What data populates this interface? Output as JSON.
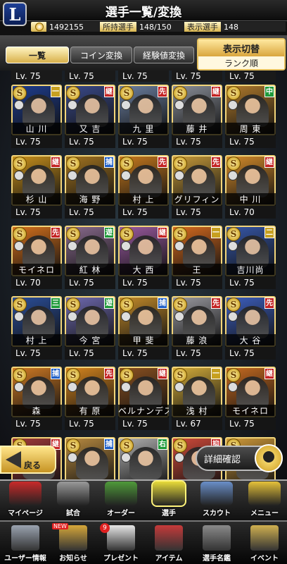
{
  "header": {
    "logo": "L",
    "title": "選手一覧/変換"
  },
  "stats": {
    "coins": "1492155",
    "owned_label": "所持選手",
    "owned_value": "148/150",
    "shown_label": "表示選手",
    "shown_value": "148"
  },
  "tabs": [
    {
      "label": "一覧",
      "active": true
    },
    {
      "label": "コイン変換",
      "active": false
    },
    {
      "label": "経験値変換",
      "active": false
    }
  ],
  "switch": {
    "label": "表示切替",
    "value": "ランク順"
  },
  "partial_row": [
    "Lv. 75",
    "Lv. 75",
    "Lv. 75",
    "Lv. 75",
    "Lv. 75"
  ],
  "cards": [
    {
      "name": "山 川",
      "lv": "Lv. 75",
      "pos": "一",
      "pos_color": "#c7a020",
      "bg": "#1e3d8f"
    },
    {
      "name": "又 吉",
      "lv": "Lv. 75",
      "pos": "継",
      "pos_color": "#c42424",
      "bg": "#3a4a8a"
    },
    {
      "name": "九 里",
      "lv": "Lv. 75",
      "pos": "先",
      "pos_color": "#c42424",
      "bg": "#6b7fa0"
    },
    {
      "name": "藤 井",
      "lv": "Lv. 75",
      "pos": "継",
      "pos_color": "#c42424",
      "bg": "#8a8f99"
    },
    {
      "name": "周 東",
      "lv": "Lv. 75",
      "pos": "中",
      "pos_color": "#1f9a3a",
      "bg": "#b07a2c"
    },
    {
      "name": "杉 山",
      "lv": "Lv. 75",
      "pos": "継",
      "pos_color": "#c42424",
      "bg": "#c8901c"
    },
    {
      "name": "海 野",
      "lv": "Lv. 75",
      "pos": "捕",
      "pos_color": "#1f5fc7",
      "bg": "#a37420"
    },
    {
      "name": "村 上",
      "lv": "Lv. 75",
      "pos": "先",
      "pos_color": "#c42424",
      "bg": "#c6791e"
    },
    {
      "name": "グリフィン",
      "lv": "Lv. 75",
      "pos": "先",
      "pos_color": "#c42424",
      "bg": "#c69a3a"
    },
    {
      "name": "中 川",
      "lv": "Lv. 70",
      "pos": "継",
      "pos_color": "#c42424",
      "bg": "#d48b2a"
    },
    {
      "name": "モイネロ",
      "lv": "Lv. 70",
      "pos": "先",
      "pos_color": "#c42424",
      "bg": "#d5701c"
    },
    {
      "name": "紅 林",
      "lv": "Lv. 75",
      "pos": "遊",
      "pos_color": "#1f9a3a",
      "bg": "#8a6b8e"
    },
    {
      "name": "大 西",
      "lv": "Lv. 75",
      "pos": "継",
      "pos_color": "#c42424",
      "bg": "#9a5aa0"
    },
    {
      "name": "王",
      "lv": "Lv. 75",
      "pos": "一",
      "pos_color": "#c7a020",
      "bg": "#d66a1e"
    },
    {
      "name": "吉川尚",
      "lv": "Lv. 75",
      "pos": "二",
      "pos_color": "#c7a020",
      "bg": "#3657a8"
    },
    {
      "name": "村 上",
      "lv": "Lv. 75",
      "pos": "三",
      "pos_color": "#1f9a3a",
      "bg": "#2b4f9a"
    },
    {
      "name": "今 宮",
      "lv": "Lv. 75",
      "pos": "遊",
      "pos_color": "#1f9a3a",
      "bg": "#6f6ab0"
    },
    {
      "name": "甲 斐",
      "lv": "Lv. 75",
      "pos": "捕",
      "pos_color": "#1f5fc7",
      "bg": "#c28a2a"
    },
    {
      "name": "藤 浪",
      "lv": "Lv. 75",
      "pos": "先",
      "pos_color": "#c42424",
      "bg": "#9a9aa0"
    },
    {
      "name": "大 谷",
      "lv": "Lv. 75",
      "pos": "先",
      "pos_color": "#c42424",
      "bg": "#3d5fbf"
    },
    {
      "name": "森",
      "lv": "Lv. 75",
      "pos": "捕",
      "pos_color": "#1f5fc7",
      "bg": "#d07a24"
    },
    {
      "name": "有 原",
      "lv": "Lv. 75",
      "pos": "先",
      "pos_color": "#c42424",
      "bg": "#d6851e"
    },
    {
      "name": "ベルナンデス",
      "lv": "Lv. 75",
      "pos": "継",
      "pos_color": "#c42424",
      "bg": "#8a5020"
    },
    {
      "name": "浅 村",
      "lv": "Lv. 67",
      "pos": "一",
      "pos_color": "#c7a020",
      "bg": "#d5ad3a"
    },
    {
      "name": "モイネロ",
      "lv": "Lv. 75",
      "pos": "継",
      "pos_color": "#c42424",
      "bg": "#c66a20"
    },
    {
      "name": "",
      "lv": "",
      "pos": "継",
      "pos_color": "#c42424",
      "bg": "#a03a3a"
    },
    {
      "name": "",
      "lv": "",
      "pos": "捕",
      "pos_color": "#1f5fc7",
      "bg": "#b88a40"
    },
    {
      "name": "",
      "lv": "",
      "pos": "右",
      "pos_color": "#1f9a3a",
      "bg": "#b0b0b0"
    },
    {
      "name": "",
      "lv": "",
      "pos": "抑",
      "pos_color": "#c42424",
      "bg": "#d04a3a"
    },
    {
      "name": "",
      "lv": "",
      "pos": "",
      "pos_color": "#c42424",
      "bg": "#d09a3a"
    }
  ],
  "buttons": {
    "back": "戻る",
    "detail": "詳細確認"
  },
  "nav_main": [
    {
      "label": "マイページ",
      "icon": "mypage-icon",
      "color": "#c92a2a"
    },
    {
      "label": "試合",
      "icon": "stadium-icon",
      "color": "#9a9a9a"
    },
    {
      "label": "オーダー",
      "icon": "field-icon",
      "color": "#4f9a3a"
    },
    {
      "label": "選手",
      "icon": "player-icon",
      "color": "#e8dc3a"
    },
    {
      "label": "スカウト",
      "icon": "scout-icon",
      "color": "#6a8fc9"
    },
    {
      "label": "メニュー",
      "icon": "menu-icon",
      "color": "#e6c23a"
    }
  ],
  "nav_sub": [
    {
      "label": "ユーザー情報",
      "icon": "user-info-icon",
      "color": "#9aa3b0",
      "badge": ""
    },
    {
      "label": "お知らせ",
      "icon": "notice-icon",
      "color": "#d6a73a",
      "badge": "NEW"
    },
    {
      "label": "プレゼント",
      "icon": "gift-icon",
      "color": "#e7e7e7",
      "badge": "9"
    },
    {
      "label": "アイテム",
      "icon": "item-icon",
      "color": "#c63a3a",
      "badge": ""
    },
    {
      "label": "選手名鑑",
      "icon": "encyclopedia-icon",
      "color": "#8a8a8a",
      "badge": ""
    },
    {
      "label": "イベント",
      "icon": "event-icon",
      "color": "#d0b050",
      "badge": ""
    }
  ]
}
